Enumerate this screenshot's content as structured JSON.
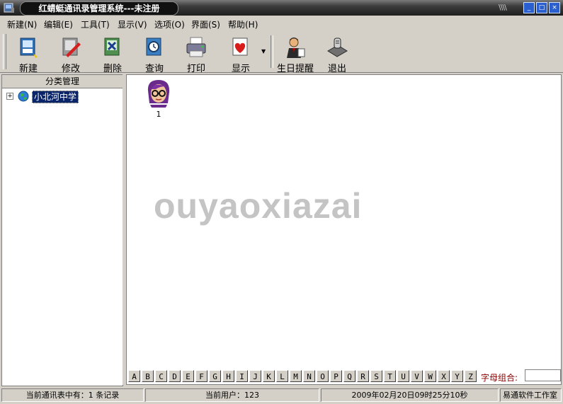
{
  "window": {
    "title": "红蜻蜓通讯录管理系统---未注册",
    "minimize_glyph": "_",
    "maximize_glyph": "□",
    "close_glyph": "×"
  },
  "menu": [
    {
      "label": "新建(N)",
      "name": "menu-new"
    },
    {
      "label": "编辑(E)",
      "name": "menu-edit"
    },
    {
      "label": "工具(T)",
      "name": "menu-tools"
    },
    {
      "label": "显示(V)",
      "name": "menu-view"
    },
    {
      "label": "选项(O)",
      "name": "menu-options"
    },
    {
      "label": "界面(S)",
      "name": "menu-skin"
    },
    {
      "label": "帮助(H)",
      "name": "menu-help"
    }
  ],
  "toolbar": {
    "new": "新建",
    "edit": "修改",
    "delete": "删除",
    "query": "查询",
    "print": "打印",
    "show": "显示",
    "birthday": "生日提醒",
    "exit": "退出"
  },
  "sidebar": {
    "header": "分类管理",
    "tree_root": "小北河中学"
  },
  "main": {
    "contacts": [
      {
        "name": "1"
      }
    ],
    "watermark": "ouyaoxiazai",
    "letters": [
      "A",
      "B",
      "C",
      "D",
      "E",
      "F",
      "G",
      "H",
      "I",
      "J",
      "K",
      "L",
      "M",
      "N",
      "O",
      "P",
      "Q",
      "R",
      "S",
      "T",
      "U",
      "V",
      "W",
      "X",
      "Y",
      "Z"
    ],
    "combo_label": "字母组合:",
    "combo_value": ""
  },
  "status": {
    "records": "当前通讯表中有：1 条记录",
    "user": "当前用户：123",
    "datetime": "2009年02月20日09时25分10秒",
    "company": "易通软件工作室"
  },
  "colors": {
    "selection": "#0a246a",
    "accent_label": "#8b0000"
  }
}
